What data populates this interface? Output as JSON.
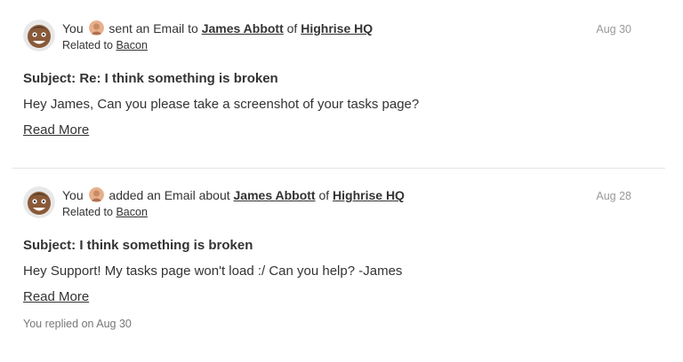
{
  "entries": [
    {
      "actor": "You",
      "action": "sent an Email to",
      "person": "James Abbott",
      "of_word": "of",
      "company": "Highrise HQ",
      "related_prefix": "Related to",
      "related": "Bacon",
      "date": "Aug 30",
      "subject": "Subject: Re: I think something is broken",
      "body": "Hey James,  Can you please take a screenshot of your tasks page?",
      "read_more": "Read More"
    },
    {
      "actor": "You",
      "action": "added an Email about",
      "person": "James Abbott",
      "of_word": "of",
      "company": "Highrise HQ",
      "related_prefix": "Related to",
      "related": "Bacon",
      "date": "Aug 28",
      "subject": "Subject: I think something is broken",
      "body": "Hey Support! My tasks page won't load :/ Can you help? -James",
      "read_more": "Read More",
      "replied": "You replied on Aug 30"
    }
  ]
}
